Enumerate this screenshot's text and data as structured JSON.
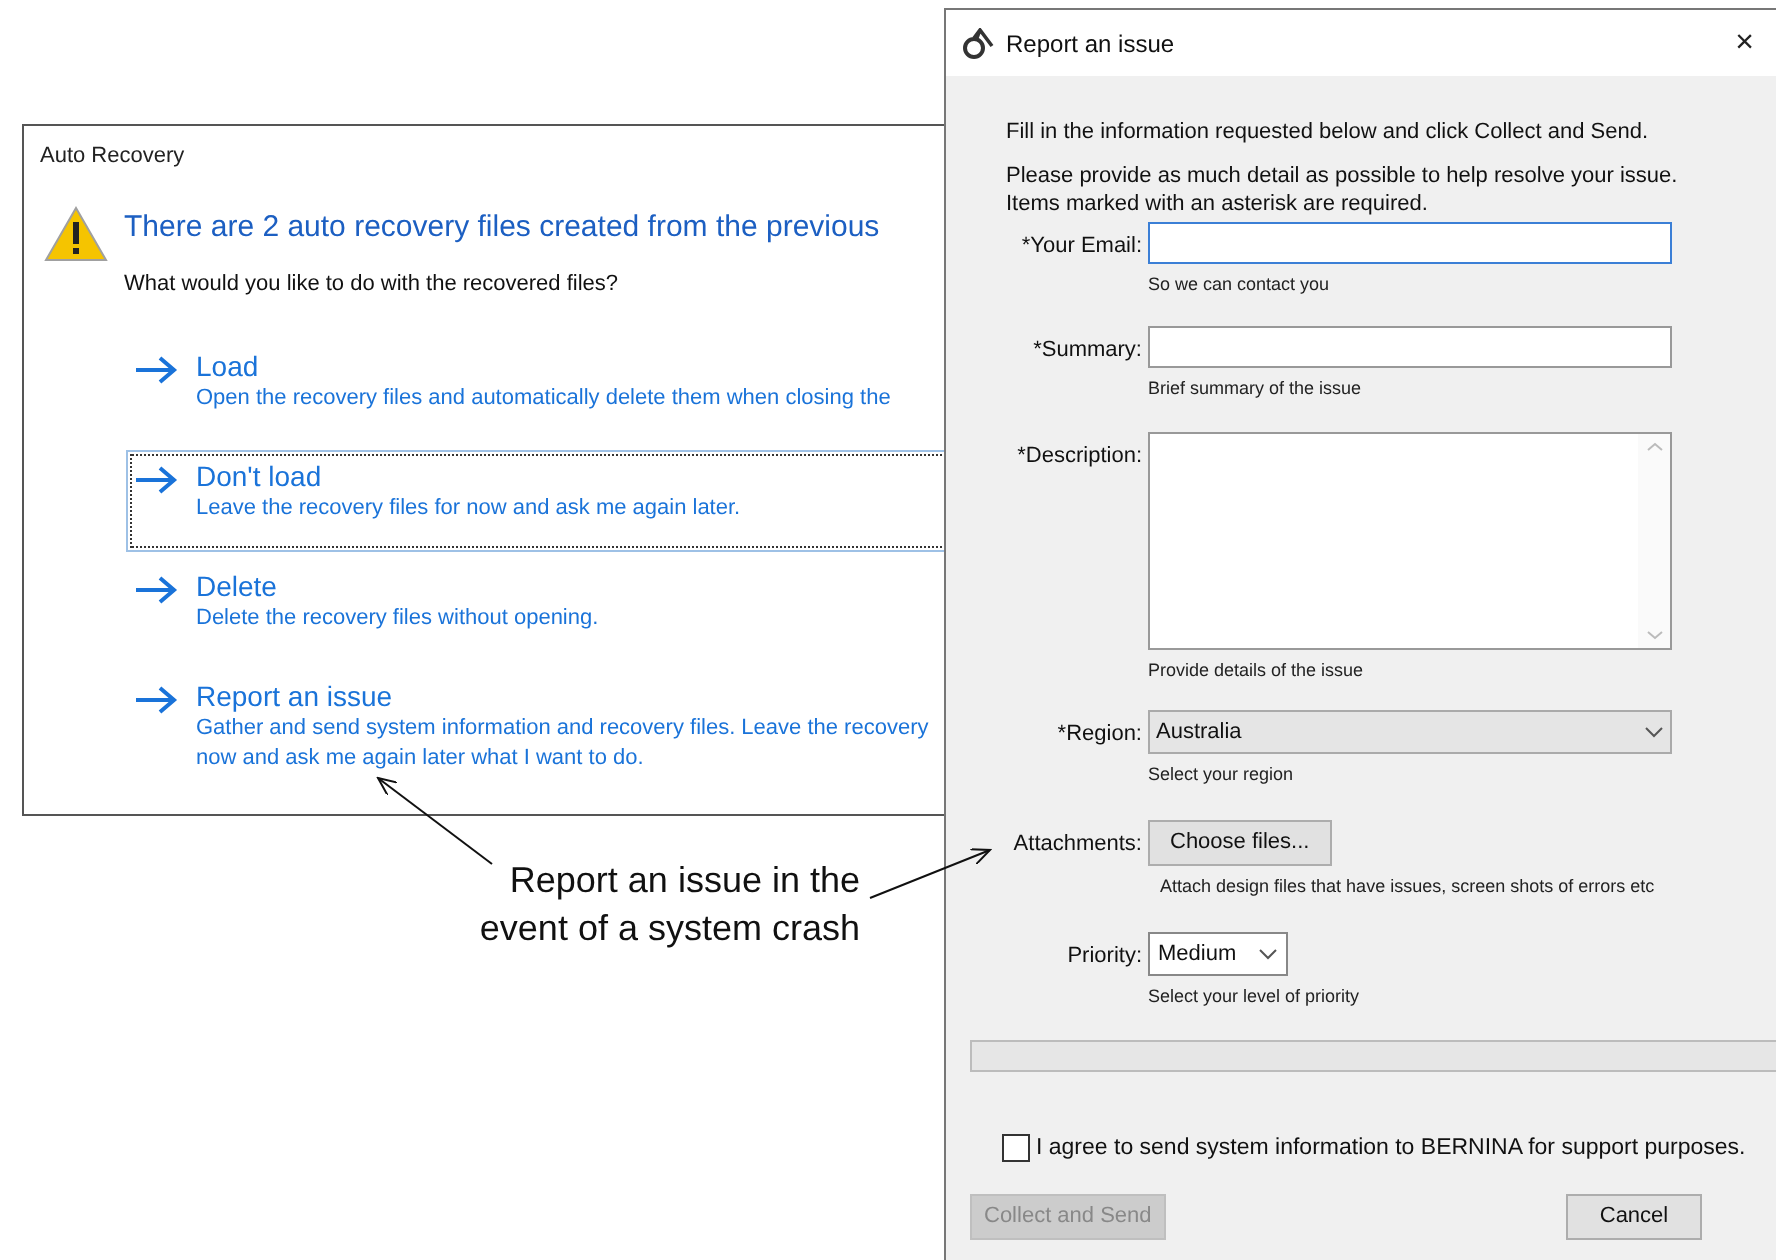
{
  "auto_recovery": {
    "title": "Auto Recovery",
    "heading": "There are 2 auto recovery files created from the  previous",
    "question": "What would you like to do with the recovered files?",
    "options": [
      {
        "title": "Load",
        "description": "Open the recovery files and automatically delete them when closing the",
        "selected": false
      },
      {
        "title": "Don't load",
        "description": "Leave the recovery files for now and ask me again later.",
        "selected": true
      },
      {
        "title": "Delete",
        "description": "Delete the recovery files without opening.",
        "selected": false
      },
      {
        "title": "Report an issue",
        "description": "Gather and send system information and recovery files. Leave the recovery",
        "description_2": "now and ask me again later what I want to do.",
        "selected": false
      }
    ]
  },
  "callout": {
    "text": "Report an issue in the event of a system crash"
  },
  "report_dialog": {
    "title": "Report an issue",
    "close": "×",
    "intro": "Fill in the information requested below and click Collect and Send.",
    "details": "Please provide as much detail as possible to help resolve your issue.",
    "required_note": "Items marked with an asterisk are required.",
    "fields": [
      {
        "kind": "input",
        "label": "*Your Email:",
        "hint": "So we can contact you"
      },
      {
        "kind": "input",
        "label": "*Summary:",
        "hint": "Brief summary of the issue"
      },
      {
        "kind": "textarea",
        "label": "*Description:",
        "hint": "Provide details of the issue"
      },
      {
        "kind": "select",
        "label": "*Region:",
        "value": "Australia",
        "hint": "Select your region"
      },
      {
        "kind": "file",
        "label": "Attachments:",
        "value": "Choose files...",
        "hint": "Attach design files that have issues, screen shots of errors etc"
      },
      {
        "kind": "small_select",
        "label": "Priority:",
        "value": "Medium",
        "hint": "Select your level of priority"
      }
    ],
    "progress": {
      "level": 0
    },
    "agree": {
      "label": "I agree to send system information to BERNINA for support purposes.",
      "checked": false
    },
    "buttons": [
      {
        "label": "Collect and Send",
        "disabled": true
      },
      {
        "label": "Cancel",
        "disabled": false
      }
    ]
  }
}
